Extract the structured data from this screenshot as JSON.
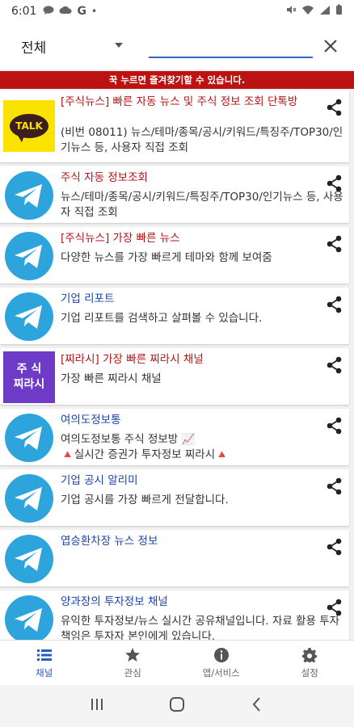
{
  "status_bar": {
    "time": "6:01",
    "icons": [
      "chat-icon",
      "cloud-icon",
      "google-icon",
      "dot-icon",
      "mute-icon",
      "wifi-icon",
      "signal-icon",
      "battery-icon"
    ],
    "google_label": "G",
    "dot_label": "•"
  },
  "header": {
    "filter_value": "전체",
    "search_value": "",
    "search_placeholder": ""
  },
  "banner": {
    "text": "꾹 누르면 즐겨찾기할 수 있습니다.",
    "color": "#bc1212"
  },
  "channels": [
    {
      "icon": "kakaotalk-icon",
      "icon_label": "TALK",
      "title": "[주식뉴스] 빠른 자동 뉴스 및 주식 정보 조회 단톡방",
      "title_color": "red",
      "desc": "(비번 08011) 뉴스/테마/종목/공시/키워드/특징주/TOP30/인기뉴스 등, 사용자 직접 조회"
    },
    {
      "icon": "telegram-icon",
      "title": "주식 자동 정보조회",
      "title_color": "red",
      "desc": "뉴스/테마/종목/공시/키워드/특징주/TOP30/인기뉴스 등, 사용자 직접 조회"
    },
    {
      "icon": "telegram-icon",
      "title": "[주식뉴스] 가장 빠른 뉴스",
      "title_color": "red",
      "desc": "다양한 뉴스를 가장 빠르게 테마와 함께 보여줌"
    },
    {
      "icon": "telegram-icon",
      "title": "기업 리포트",
      "title_color": "blue",
      "desc": "기업 리포트를 검색하고 살펴볼 수 있습니다."
    },
    {
      "icon": "stock-chirashi-icon",
      "icon_label_1": "주 식",
      "icon_label_2": "찌라시",
      "title": "[찌라시] 가장 빠른 찌라시 채널",
      "title_color": "red",
      "desc": "가장 빠른 찌라시 채널"
    },
    {
      "icon": "telegram-icon",
      "title": "여의도정보통",
      "title_color": "blue",
      "desc_line1": "여의도정보통 주식 정보방 📈",
      "desc_line2": "🔺실시간 증권가 투자정보 찌라시🔺"
    },
    {
      "icon": "telegram-icon",
      "title": "기업 공시 알리미",
      "title_color": "blue",
      "desc": "기업 공시를 가장 빠르게 전달합니다."
    },
    {
      "icon": "telegram-icon",
      "title": "엽승환차장 뉴스 정보",
      "title_color": "blue",
      "desc": ""
    },
    {
      "icon": "telegram-icon",
      "title": "양과장의 투자정보 채널",
      "title_color": "blue",
      "desc": "유익한 투자정보/뉴스 실시간 공유채널입니다. 자료 활용 투자 책임은 투자자 본인에게 있습니다."
    }
  ],
  "bottom_nav": [
    {
      "label": "채널",
      "icon": "list-icon",
      "active": true
    },
    {
      "label": "관심",
      "icon": "star-icon",
      "active": false
    },
    {
      "label": "앱/서비스",
      "icon": "info-icon",
      "active": false
    },
    {
      "label": "설정",
      "icon": "gear-icon",
      "active": false
    }
  ],
  "colors": {
    "red_title": "#b11414",
    "blue_title": "#1a43a8",
    "accent": "#2a5ec2",
    "telegram": "#2ea4dc",
    "kakao": "#fce200",
    "purple": "#6d3bc5"
  }
}
